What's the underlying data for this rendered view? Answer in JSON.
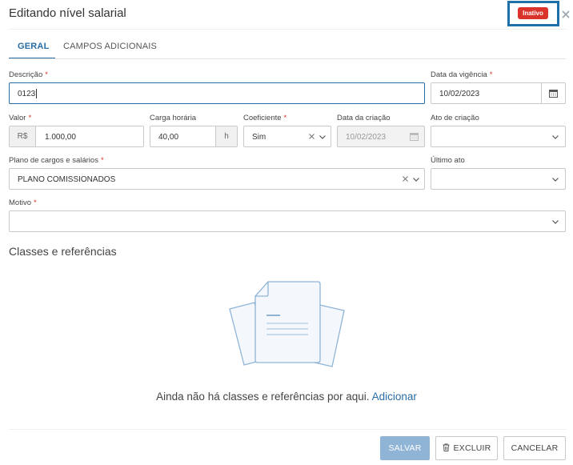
{
  "header": {
    "title": "Editando nível salarial",
    "status_badge": "Inativo",
    "status_color": "#d9332b",
    "close_icon": "close-icon"
  },
  "tabs": [
    {
      "label": "GERAL",
      "active": true
    },
    {
      "label": "CAMPOS ADICIONAIS",
      "active": false
    }
  ],
  "form": {
    "descricao": {
      "label": "Descrição",
      "value": "0123",
      "required": true
    },
    "data_vigencia": {
      "label": "Data da vigência",
      "value": "10/02/2023",
      "required": true
    },
    "valor": {
      "label": "Valor",
      "prefix": "R$",
      "value": "1.000,00",
      "required": true
    },
    "carga_horaria": {
      "label": "Carga horária",
      "value": "40,00",
      "suffix": "h"
    },
    "coeficiente": {
      "label": "Coeficiente",
      "value": "Sim",
      "required": true
    },
    "data_criacao": {
      "label": "Data da criação",
      "value": "10/02/2023"
    },
    "ato_criacao": {
      "label": "Ato de criação",
      "value": ""
    },
    "plano": {
      "label": "Plano de cargos e salários",
      "value": "PLANO COMISSIONADOS",
      "required": true
    },
    "ultimo_ato": {
      "label": "Último ato",
      "value": ""
    },
    "motivo": {
      "label": "Motivo",
      "value": "",
      "required": true
    }
  },
  "classes": {
    "title": "Classes e referências",
    "empty_text": "Ainda não há classes e referências por aqui.",
    "add_link": "Adicionar"
  },
  "footer": {
    "save": "SALVAR",
    "delete": "EXCLUIR",
    "cancel": "CANCELAR"
  },
  "colors": {
    "accent": "#2a6da5",
    "primary_button": "#8fb4d6",
    "required": "#d9332b"
  }
}
